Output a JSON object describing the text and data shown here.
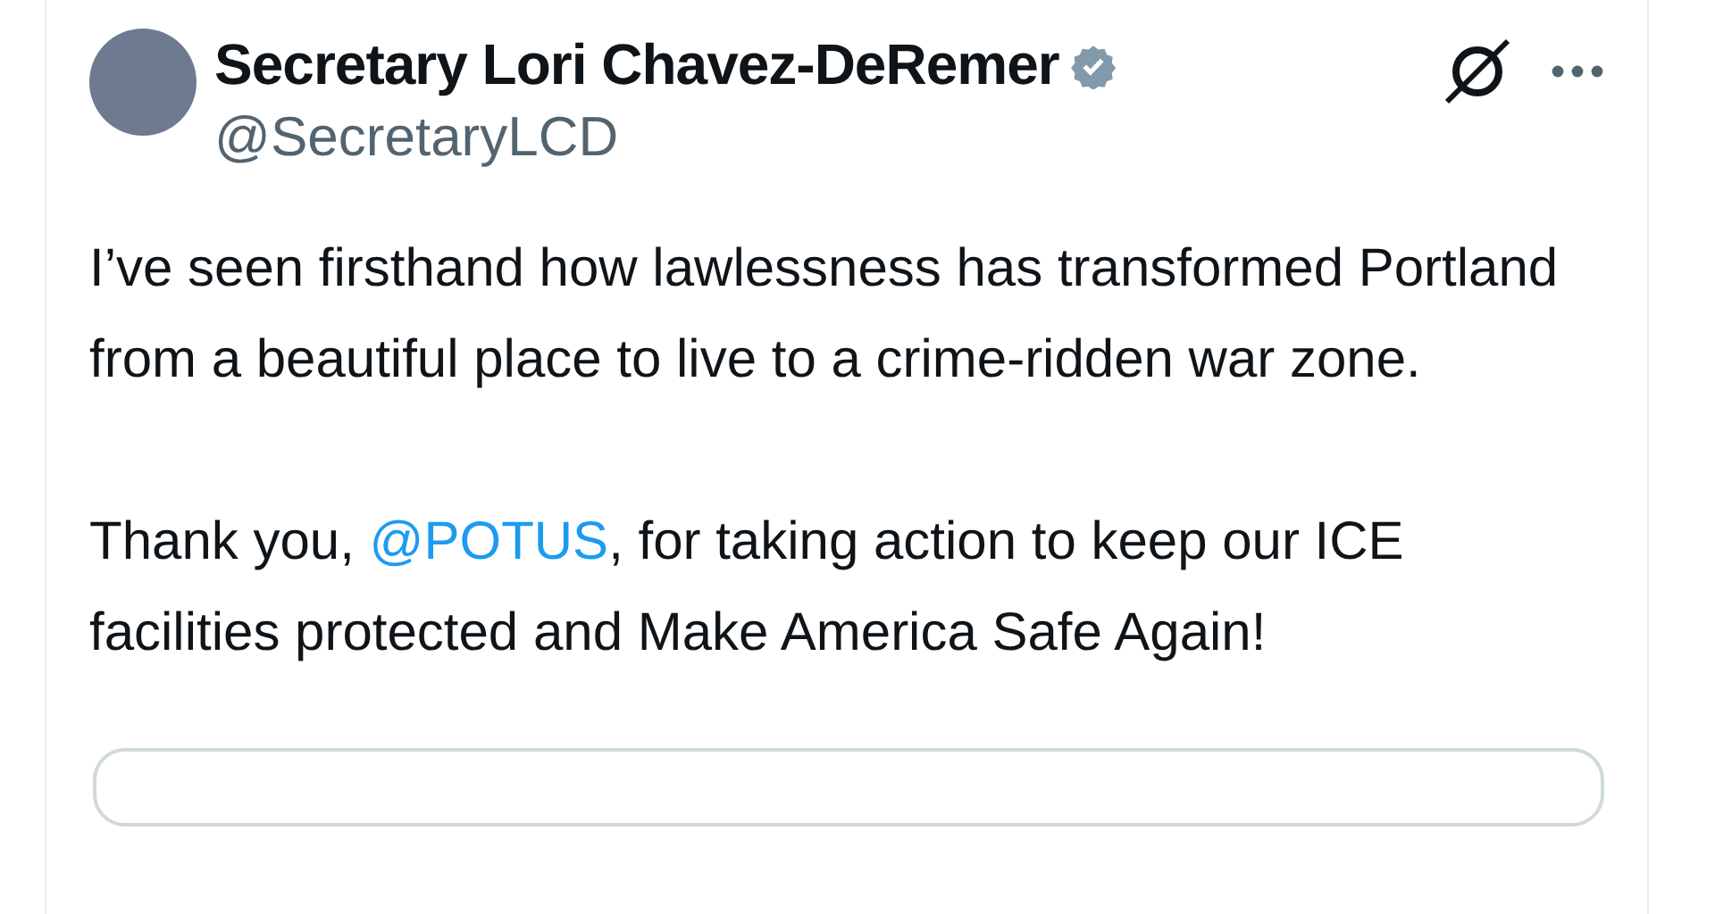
{
  "author": {
    "name": "Secretary Lori Chavez-DeRemer",
    "verified": true,
    "handle": "@SecretaryLCD"
  },
  "body": [
    {
      "text": "I’ve seen firsthand how lawlessness has transformed Portland from a beautiful place to live to a crime-ridden war zone."
    },
    {
      "before": "Thank you, ",
      "mention": "@POTUS",
      "after": ", for taking action to keep our ICE facilities protected and Make America Safe Again!"
    }
  ]
}
